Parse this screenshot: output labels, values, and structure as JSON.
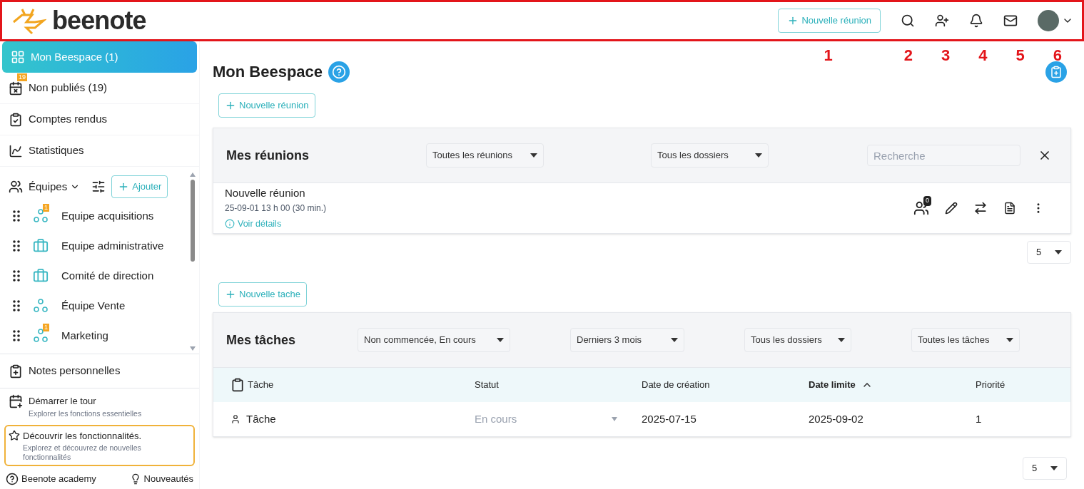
{
  "header": {
    "logo": "beenote",
    "new_meeting": "Nouvelle réunion",
    "callouts": [
      "1",
      "2",
      "3",
      "4",
      "5",
      "6"
    ]
  },
  "sidebar": {
    "items": [
      {
        "label": "Mon Beespace (1)",
        "selected": true
      },
      {
        "label": "Non publiés (19)",
        "badge": "19",
        "selected": false
      },
      {
        "label": "Comptes rendus",
        "selected": false
      },
      {
        "label": "Statistiques",
        "selected": false
      }
    ],
    "teams": {
      "label": "Équipes",
      "add": "Ajouter",
      "expanded": true,
      "items": [
        {
          "name": "Equipe acquisitions",
          "kind": "team",
          "badge": "1"
        },
        {
          "name": "Equipe administrative",
          "kind": "briefcase"
        },
        {
          "name": "Comité de direction",
          "kind": "briefcase"
        },
        {
          "name": "Équipe Vente",
          "kind": "team"
        },
        {
          "name": "Marketing",
          "kind": "team",
          "badge": "1"
        }
      ]
    },
    "notes": "Notes personnelles",
    "tour": {
      "title": "Démarrer le tour",
      "subtitle": "Explorer les fonctions essentielles"
    },
    "discover": {
      "title": "Découvrir les fonctionnalités.",
      "subtitle": "Explorez et découvrez de nouvelles fonctionnalités"
    },
    "academy": "Beenote academy",
    "news": "Nouveautés"
  },
  "page": {
    "title": "Mon Beespace",
    "new_meeting": "Nouvelle réunion",
    "new_task": "Nouvelle tache"
  },
  "meetings": {
    "title": "Mes réunions",
    "filters": [
      "Toutes les réunions",
      "Tous les dossiers"
    ],
    "search_placeholder": "Recherche",
    "rows": [
      {
        "title": "Nouvelle réunion",
        "time": "25-09-01 13 h 00 (30 min.)",
        "details": "Voir détails",
        "participants": "0"
      }
    ],
    "page_size": "5"
  },
  "tasks": {
    "title": "Mes tâches",
    "filters": [
      "Non commencée, En cours",
      "Derniers 3 mois",
      "Tous les dossiers",
      "Toutes les tâches"
    ],
    "columns": [
      {
        "label": "Tâche",
        "sorted": false
      },
      {
        "label": "Statut",
        "sorted": false
      },
      {
        "label": "Date de création",
        "sorted": false
      },
      {
        "label": "Date limite",
        "sorted": true
      },
      {
        "label": "Priorité",
        "sorted": false
      }
    ],
    "rows": [
      {
        "task": "Tâche",
        "status": "En cours",
        "created": "2025-07-15",
        "due": "2025-09-02",
        "priority": "1"
      }
    ],
    "page_size": "5"
  }
}
